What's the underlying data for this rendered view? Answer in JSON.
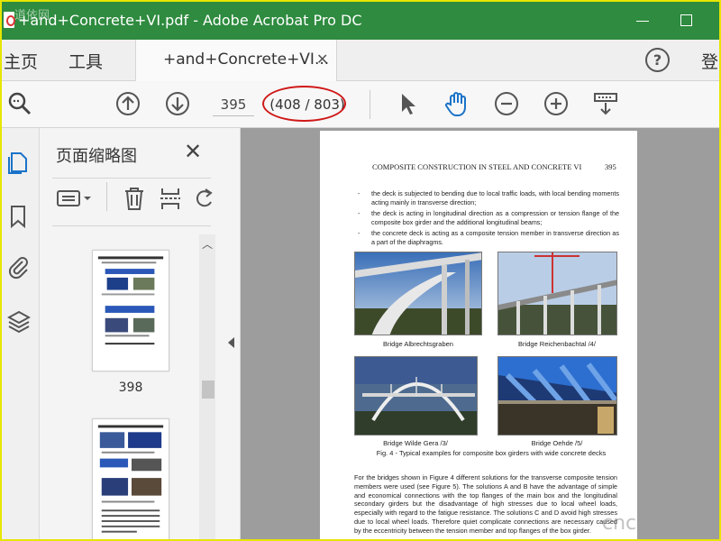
{
  "window": {
    "title": "+and+Concrete+VI.pdf - Adobe Acrobat Pro DC",
    "watermark": "道依网"
  },
  "tabs": {
    "home": "主页",
    "tools": "工具",
    "document": "+and+Concrete+VI...",
    "signin": "登"
  },
  "toolbar": {
    "page_input": "395",
    "page_count": "(408 / 803)"
  },
  "thumbnails": {
    "title": "页面缩略图",
    "label_1": "398"
  },
  "document": {
    "header": "COMPOSITE CONSTRUCTION IN STEEL AND CONCRETE VI",
    "page_number": "395",
    "bullets": [
      "the deck is subjected to bending due to local traffic loads, with local bending moments acting mainly in transverse direction;",
      "the deck is acting in longitudinal direction as a compression or tension flange of the composite box girder and the additional longitudinal beams;",
      "the concrete deck is acting as a composite tension member in transverse direction as a part of the diaphragms."
    ],
    "captions": [
      "Bridge Albrechtsgraben",
      "Bridge Reichenbachtal /4/",
      "Bridge Wilde Gera /3/",
      "Bridge Oehde /5/"
    ],
    "figure_caption": "Fig. 4 - Typical examples for composite box girders with wide concrete decks",
    "paragraph": "For the bridges shown in Figure 4 different solutions for the transverse composite tension members were used (see Figure 5). The solutions A and B have the advantage of simple and economical connections with the top flanges of the main box and the longitudinal secondary girders but the disadvantage of high stresses due to local wheel loads, especially with regard to the fatigue resistance. The solutions C and D avoid high stresses due to local wheel loads. Therefore quiet complicate connections are necessary caused by the eccentricity between the tension member and top flanges of the box girder."
  },
  "corner_watermark": "cnc",
  "colors": {
    "titlebar": "#2e8b3f",
    "frame": "#e6e600",
    "highlight": "#d01818",
    "accent_blue": "#1a73c9"
  }
}
